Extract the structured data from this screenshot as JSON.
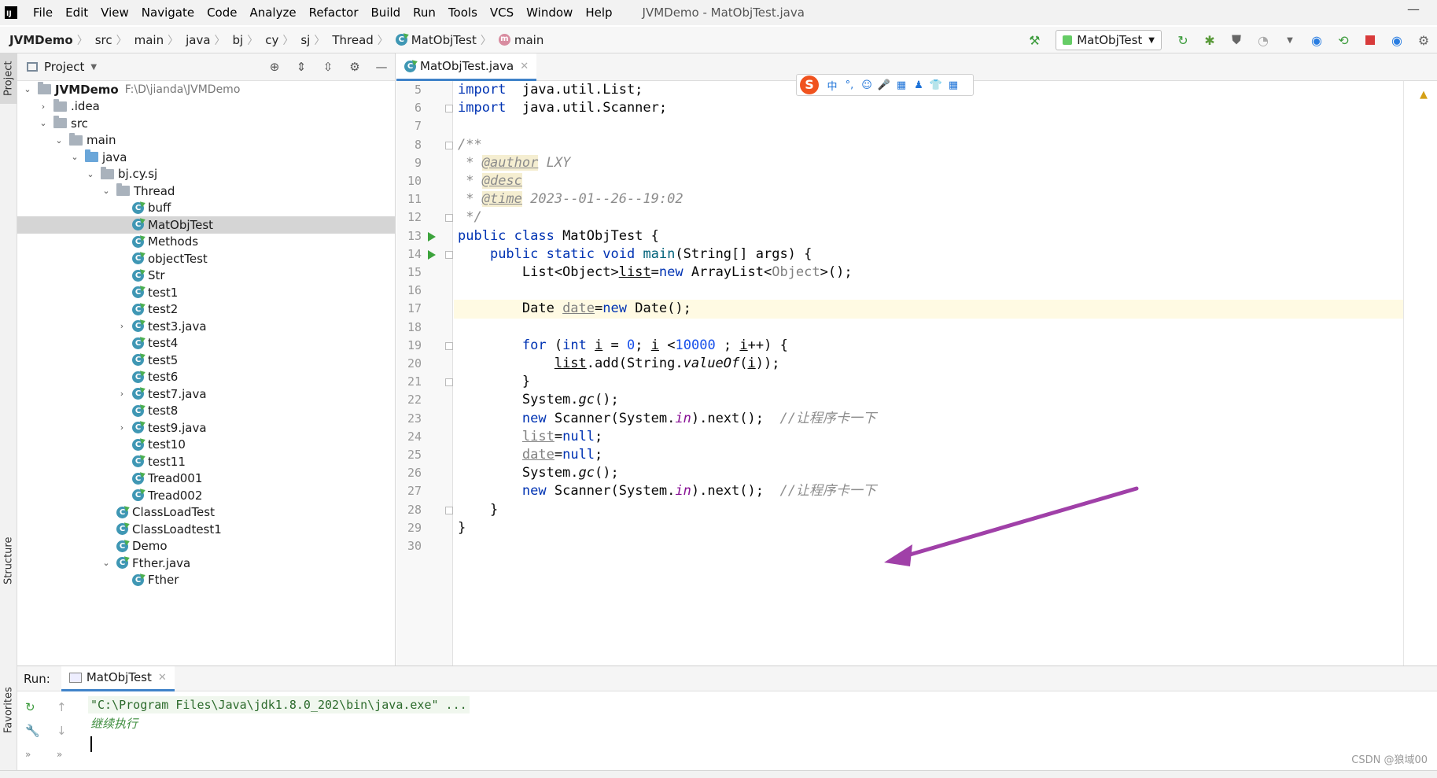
{
  "menubar": {
    "items": [
      "File",
      "Edit",
      "View",
      "Navigate",
      "Code",
      "Analyze",
      "Refactor",
      "Build",
      "Run",
      "Tools",
      "VCS",
      "Window",
      "Help"
    ],
    "window_title": "JVMDemo - MatObjTest.java"
  },
  "breadcrumbs": {
    "items": [
      "JVMDemo",
      "src",
      "main",
      "java",
      "bj",
      "cy",
      "sj",
      "Thread",
      "MatObjTest",
      "main"
    ]
  },
  "run_config": {
    "label": "MatObjTest"
  },
  "left_stripe": {
    "project": "Project",
    "structure": "Structure",
    "favorites": "Favorites"
  },
  "project_panel": {
    "title": "Project",
    "tree": [
      {
        "label": "JVMDemo",
        "path": "F:\\D\\jianda\\JVMDemo",
        "depth": 0,
        "icon": "folder",
        "expanded": true,
        "bold": true
      },
      {
        "label": ".idea",
        "depth": 1,
        "icon": "folder",
        "expanded": false
      },
      {
        "label": "src",
        "depth": 1,
        "icon": "folder",
        "expanded": true
      },
      {
        "label": "main",
        "depth": 2,
        "icon": "folder",
        "expanded": true
      },
      {
        "label": "java",
        "depth": 3,
        "icon": "folder-blue",
        "expanded": true
      },
      {
        "label": "bj.cy.sj",
        "depth": 4,
        "icon": "folder",
        "expanded": true
      },
      {
        "label": "Thread",
        "depth": 5,
        "icon": "folder",
        "expanded": true
      },
      {
        "label": "buff",
        "depth": 6,
        "icon": "class"
      },
      {
        "label": "MatObjTest",
        "depth": 6,
        "icon": "class",
        "selected": true
      },
      {
        "label": "Methods",
        "depth": 6,
        "icon": "class"
      },
      {
        "label": "objectTest",
        "depth": 6,
        "icon": "class"
      },
      {
        "label": "Str",
        "depth": 6,
        "icon": "class"
      },
      {
        "label": "test1",
        "depth": 6,
        "icon": "class"
      },
      {
        "label": "test2",
        "depth": 6,
        "icon": "class"
      },
      {
        "label": "test3.java",
        "depth": 6,
        "icon": "class",
        "expanded": false
      },
      {
        "label": "test4",
        "depth": 6,
        "icon": "class"
      },
      {
        "label": "test5",
        "depth": 6,
        "icon": "class"
      },
      {
        "label": "test6",
        "depth": 6,
        "icon": "class"
      },
      {
        "label": "test7.java",
        "depth": 6,
        "icon": "class",
        "expanded": false
      },
      {
        "label": "test8",
        "depth": 6,
        "icon": "class"
      },
      {
        "label": "test9.java",
        "depth": 6,
        "icon": "class",
        "expanded": false
      },
      {
        "label": "test10",
        "depth": 6,
        "icon": "class"
      },
      {
        "label": "test11",
        "depth": 6,
        "icon": "class"
      },
      {
        "label": "Tread001",
        "depth": 6,
        "icon": "class"
      },
      {
        "label": "Tread002",
        "depth": 6,
        "icon": "class"
      },
      {
        "label": "ClassLoadTest",
        "depth": 5,
        "icon": "class"
      },
      {
        "label": "ClassLoadtest1",
        "depth": 5,
        "icon": "class"
      },
      {
        "label": "Demo",
        "depth": 5,
        "icon": "class"
      },
      {
        "label": "Fther.java",
        "depth": 5,
        "icon": "class",
        "expanded": true
      },
      {
        "label": "Fther",
        "depth": 6,
        "icon": "class"
      }
    ]
  },
  "editor": {
    "tab_label": "MatObjTest.java",
    "current_line": 17,
    "lines": [
      {
        "no": "5",
        "tokens": [
          [
            "kw",
            "import"
          ],
          [
            "",
            "  java.util.List;"
          ]
        ]
      },
      {
        "no": "6",
        "tokens": [
          [
            "kw",
            "import"
          ],
          [
            "",
            "  java.util.Scanner;"
          ]
        ]
      },
      {
        "no": "7",
        "tokens": []
      },
      {
        "no": "8",
        "tokens": [
          [
            "cm",
            "/**"
          ]
        ]
      },
      {
        "no": "9",
        "tokens": [
          [
            "cm",
            " * "
          ],
          [
            "tag",
            "@author"
          ],
          [
            "cm",
            " LXY"
          ]
        ]
      },
      {
        "no": "10",
        "tokens": [
          [
            "cm",
            " * "
          ],
          [
            "tag",
            "@desc"
          ]
        ]
      },
      {
        "no": "11",
        "tokens": [
          [
            "cm",
            " * "
          ],
          [
            "tag",
            "@time"
          ],
          [
            "cm",
            " 2023--01--26--19:02"
          ]
        ]
      },
      {
        "no": "12",
        "tokens": [
          [
            "cm",
            " */"
          ]
        ]
      },
      {
        "no": "13",
        "tokens": [
          [
            "kw",
            "public class"
          ],
          [
            "",
            " MatObjTest {"
          ]
        ]
      },
      {
        "no": "14",
        "tokens": [
          [
            "",
            "    "
          ],
          [
            "kw",
            "public static void"
          ],
          [
            "",
            " "
          ],
          [
            "fn",
            "main"
          ],
          [
            "",
            "(String[] args) {"
          ]
        ]
      },
      {
        "no": "15",
        "tokens": [
          [
            "",
            "        List<Object>"
          ],
          [
            "ul",
            "list"
          ],
          [
            "",
            "="
          ],
          [
            "kw",
            "new"
          ],
          [
            "",
            " ArrayList<"
          ],
          [
            "gv",
            "Object"
          ],
          [
            "",
            ">();"
          ]
        ]
      },
      {
        "no": "16",
        "tokens": []
      },
      {
        "no": "17",
        "tokens": [
          [
            "",
            "        Date "
          ],
          [
            "ul gv",
            "date"
          ],
          [
            "",
            "="
          ],
          [
            "kw",
            "new"
          ],
          [
            "",
            " Date();"
          ]
        ]
      },
      {
        "no": "18",
        "tokens": []
      },
      {
        "no": "19",
        "tokens": [
          [
            "",
            "        "
          ],
          [
            "kw",
            "for"
          ],
          [
            "",
            " ("
          ],
          [
            "kw",
            "int"
          ],
          [
            "",
            " "
          ],
          [
            "ul",
            "i"
          ],
          [
            "",
            " = "
          ],
          [
            "num",
            "0"
          ],
          [
            "",
            "; "
          ],
          [
            "ul",
            "i"
          ],
          [
            "",
            " <"
          ],
          [
            "num",
            "10000"
          ],
          [
            "",
            " ; "
          ],
          [
            "ul",
            "i"
          ],
          [
            "",
            "++) {"
          ]
        ]
      },
      {
        "no": "20",
        "tokens": [
          [
            "",
            "            "
          ],
          [
            "ul",
            "list"
          ],
          [
            "",
            ".add(String."
          ],
          [
            "st",
            "valueOf"
          ],
          [
            "",
            "("
          ],
          [
            "ul",
            "i"
          ],
          [
            "",
            "));"
          ]
        ]
      },
      {
        "no": "21",
        "tokens": [
          [
            "",
            "        }"
          ]
        ]
      },
      {
        "no": "22",
        "tokens": [
          [
            "",
            "        System."
          ],
          [
            "st",
            "gc"
          ],
          [
            "",
            "();"
          ]
        ]
      },
      {
        "no": "23",
        "tokens": [
          [
            "",
            "        "
          ],
          [
            "kw",
            "new"
          ],
          [
            "",
            " Scanner(System."
          ],
          [
            "pf",
            "in"
          ],
          [
            "",
            ").next();  "
          ],
          [
            "cn",
            "//让程序卡一下"
          ]
        ]
      },
      {
        "no": "24",
        "tokens": [
          [
            "",
            "        "
          ],
          [
            "ul gv",
            "list"
          ],
          [
            "",
            "="
          ],
          [
            "kw",
            "null"
          ],
          [
            "",
            ";"
          ]
        ]
      },
      {
        "no": "25",
        "tokens": [
          [
            "",
            "        "
          ],
          [
            "ul gv",
            "date"
          ],
          [
            "",
            "="
          ],
          [
            "kw",
            "null"
          ],
          [
            "",
            ";"
          ]
        ]
      },
      {
        "no": "26",
        "tokens": [
          [
            "",
            "        System."
          ],
          [
            "st",
            "gc"
          ],
          [
            "",
            "();"
          ]
        ]
      },
      {
        "no": "27",
        "tokens": [
          [
            "",
            "        "
          ],
          [
            "kw",
            "new"
          ],
          [
            "",
            " Scanner(System."
          ],
          [
            "pf",
            "in"
          ],
          [
            "",
            ").next();  "
          ],
          [
            "cn",
            "//让程序卡一下"
          ]
        ]
      },
      {
        "no": "28",
        "tokens": [
          [
            "",
            "    }"
          ]
        ]
      },
      {
        "no": "29",
        "tokens": [
          [
            "",
            "}"
          ]
        ]
      },
      {
        "no": "30",
        "tokens": []
      }
    ],
    "run_markers": [
      "13",
      "14"
    ],
    "fold_markers": [
      "6",
      "8",
      "12",
      "14",
      "19",
      "21",
      "28"
    ]
  },
  "ime_bar": {
    "logo": "S",
    "mode": "中",
    "buttons": [
      "°,",
      "☺",
      "🎤",
      "▦",
      "♟",
      "👕",
      "▦"
    ]
  },
  "run_panel": {
    "label": "Run:",
    "tab_label": "MatObjTest",
    "command": "\"C:\\Program Files\\Java\\jdk1.8.0_202\\bin\\java.exe\" ...",
    "output": "继续执行"
  },
  "watermark": "CSDN @狼域00",
  "colors": {
    "accent": "#4083c9",
    "keyword": "#0033b3",
    "comment": "#8c8c8c",
    "arrow": "#a040a8"
  }
}
